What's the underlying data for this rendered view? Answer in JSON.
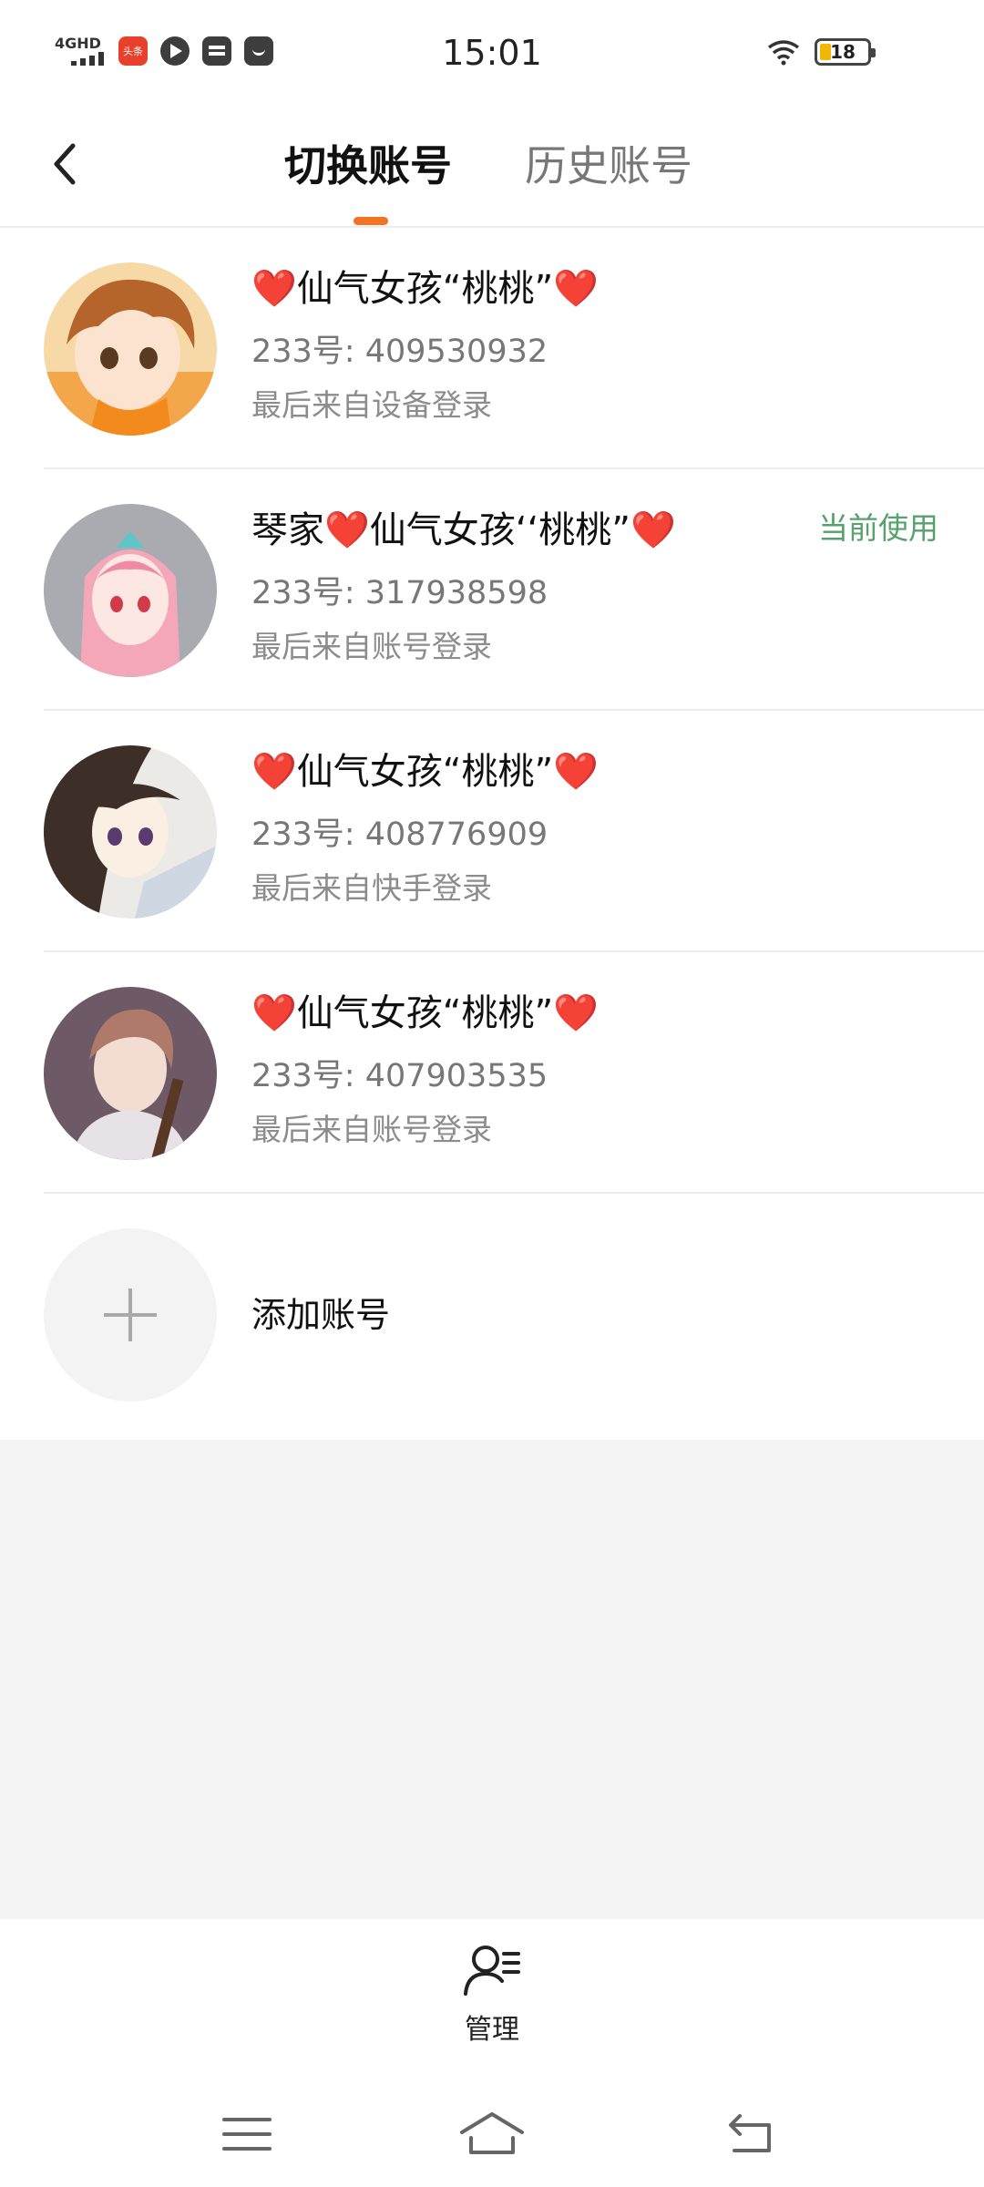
{
  "status_bar": {
    "network": "4GHD",
    "time": "15:01",
    "battery": "18",
    "app_badge": "头条"
  },
  "header": {
    "tabs": [
      {
        "label": "切换账号",
        "active": true
      },
      {
        "label": "历史账号",
        "active": false
      }
    ],
    "accent": "#f27321"
  },
  "accounts": [
    {
      "name": "❤️仙气女孩“桃桃”❤️",
      "uid": "233号: 409530932",
      "last_login": "最后来自设备登录",
      "current": ""
    },
    {
      "name": "琴家❤️仙气女孩‘‘桃桃”❤️",
      "uid": "233号: 317938598",
      "last_login": "最后来自账号登录",
      "current": "当前使用"
    },
    {
      "name": "❤️仙气女孩“桃桃”❤️",
      "uid": "233号: 408776909",
      "last_login": "最后来自快手登录",
      "current": ""
    },
    {
      "name": "❤️仙气女孩“桃桃”❤️",
      "uid": "233号: 407903535",
      "last_login": "最后来自账号登录",
      "current": ""
    }
  ],
  "add_account": {
    "label": "添加账号"
  },
  "bottom": {
    "manage_label": "管理"
  },
  "colors": {
    "current_green": "#55a26b",
    "muted_text": "#777777",
    "gray_bg": "#f4f4f4"
  }
}
